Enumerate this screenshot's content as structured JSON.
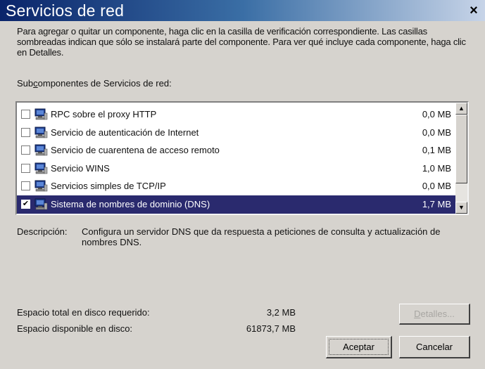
{
  "window": {
    "title": "Servicios de red",
    "close_label": "×"
  },
  "instructions": "Para agregar o quitar un componente, haga clic en la casilla de verificación correspondiente. Las casillas sombreadas indican que sólo se instalará parte del componente. Para ver qué incluye cada componente, haga clic en Detalles.",
  "list": {
    "label_pre": "Sub",
    "label_accel": "c",
    "label_post": "omponentes de Servicios de red:",
    "items": [
      {
        "label": "RPC sobre el proxy HTTP",
        "size": "0,0 MB",
        "checked": false,
        "selected": false
      },
      {
        "label": "Servicio de autenticación de Internet",
        "size": "0,0 MB",
        "checked": false,
        "selected": false
      },
      {
        "label": "Servicio de cuarentena de acceso remoto",
        "size": "0,1 MB",
        "checked": false,
        "selected": false
      },
      {
        "label": "Servicio WINS",
        "size": "1,0 MB",
        "checked": false,
        "selected": false
      },
      {
        "label": "Servicios simples de TCP/IP",
        "size": "0,0 MB",
        "checked": false,
        "selected": false
      },
      {
        "label": "Sistema de nombres de dominio (DNS)",
        "size": "1,7 MB",
        "checked": true,
        "selected": true
      }
    ],
    "check_mark": "✔",
    "scroll_up_glyph": "▲",
    "scroll_down_glyph": "▼"
  },
  "description": {
    "label": "Descripción:",
    "text": "Configura un servidor DNS que da respuesta a peticiones de consulta y actualización de nombres DNS."
  },
  "disk": {
    "required_label": "Espacio total en disco requerido:",
    "required_value": "3,2 MB",
    "available_label": "Espacio disponible en disco:",
    "available_value": "61873,7 MB"
  },
  "buttons": {
    "details_accel": "D",
    "details_rest": "etalles...",
    "ok": "Aceptar",
    "cancel": "Cancelar"
  },
  "colors": {
    "title_bar_start": "#0a246a",
    "dialog_face": "#d6d3ce",
    "selection": "#2a2a6e"
  },
  "icons": {
    "item": "network-computer-icon",
    "close": "close-icon"
  }
}
